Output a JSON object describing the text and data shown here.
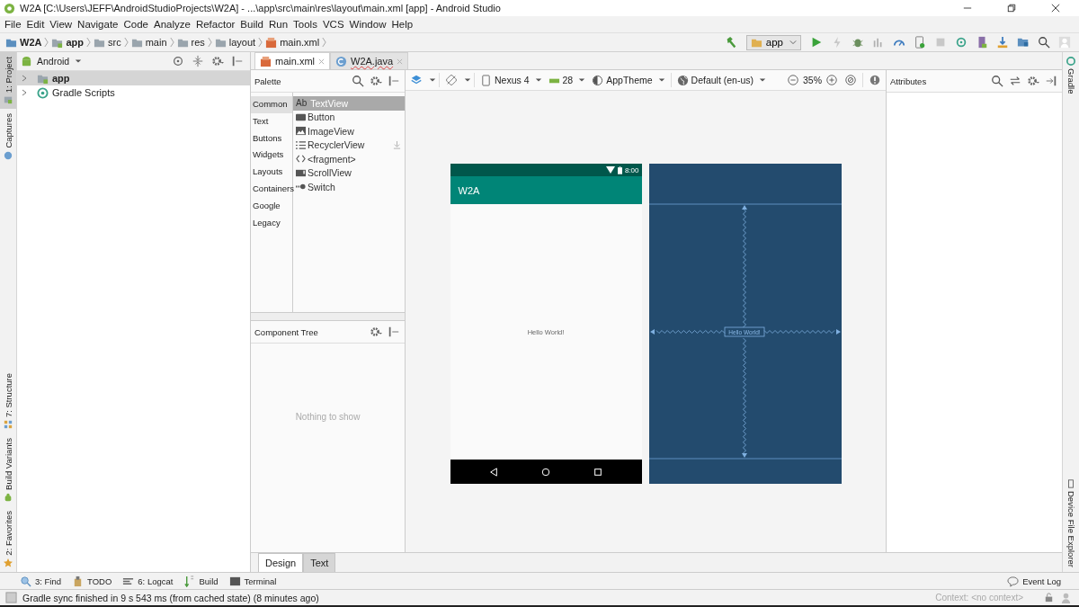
{
  "window": {
    "title": "W2A [C:\\Users\\JEFF\\AndroidStudioProjects\\W2A] - ...\\app\\src\\main\\res\\layout\\main.xml [app] - Android Studio"
  },
  "menu": [
    "File",
    "Edit",
    "View",
    "Navigate",
    "Code",
    "Analyze",
    "Refactor",
    "Build",
    "Run",
    "Tools",
    "VCS",
    "Window",
    "Help"
  ],
  "breadcrumbs": [
    {
      "label": "W2A",
      "kind": "project"
    },
    {
      "label": "app",
      "kind": "module"
    },
    {
      "label": "src",
      "kind": "folder"
    },
    {
      "label": "main",
      "kind": "folder"
    },
    {
      "label": "res",
      "kind": "folder"
    },
    {
      "label": "layout",
      "kind": "folder"
    },
    {
      "label": "main.xml",
      "kind": "file"
    }
  ],
  "run_config": "app",
  "left_tool_tabs_top": [
    {
      "label": "1: Project",
      "selected": true
    },
    {
      "label": "Captures",
      "selected": false
    }
  ],
  "left_tool_tabs_bottom": [
    {
      "label": "7: Structure",
      "selected": false
    },
    {
      "label": "Build Variants",
      "selected": false
    },
    {
      "label": "2: Favorites",
      "selected": false
    }
  ],
  "right_tool_tabs_top": [
    "Gradle"
  ],
  "right_tool_tabs_bottom": [
    "Device File Explorer"
  ],
  "project_panel": {
    "view": "Android",
    "tree": [
      {
        "label": "app",
        "expanded": false,
        "selected": true,
        "kind": "module"
      },
      {
        "label": "Gradle Scripts",
        "expanded": false,
        "selected": false,
        "kind": "gradle"
      }
    ]
  },
  "editor_tabs": [
    {
      "label": "main.xml",
      "selected": true,
      "kind": "xml"
    },
    {
      "label": "W2A.java",
      "selected": false,
      "kind": "java"
    }
  ],
  "palette": {
    "title": "Palette",
    "categories": [
      {
        "label": "Common",
        "selected": true
      },
      {
        "label": "Text",
        "selected": false
      },
      {
        "label": "Buttons",
        "selected": false
      },
      {
        "label": "Widgets",
        "selected": false
      },
      {
        "label": "Layouts",
        "selected": false
      },
      {
        "label": "Containers",
        "selected": false
      },
      {
        "label": "Google",
        "selected": false
      },
      {
        "label": "Legacy",
        "selected": false
      }
    ],
    "items": [
      {
        "label": "TextView",
        "kind": "text",
        "glyph": "Ab",
        "selected": true
      },
      {
        "label": "Button",
        "kind": "button",
        "selected": false
      },
      {
        "label": "ImageView",
        "kind": "image",
        "selected": false
      },
      {
        "label": "RecyclerView",
        "kind": "list",
        "selected": false,
        "download": true
      },
      {
        "label": "<fragment>",
        "kind": "fragment",
        "selected": false
      },
      {
        "label": "ScrollView",
        "kind": "scroll",
        "selected": false
      },
      {
        "label": "Switch",
        "kind": "switch",
        "selected": false
      }
    ]
  },
  "component_tree": {
    "title": "Component Tree",
    "empty_message": "Nothing to show"
  },
  "design_toolbar": {
    "device": "Nexus 4",
    "api": "28",
    "theme": "AppTheme",
    "locale": "Default (en-us)",
    "zoom": "35%"
  },
  "preview": {
    "status_time": "8:00",
    "app_title": "W2A",
    "content_text": "Hello World!"
  },
  "blueprint": {
    "content_text": "Hello World!"
  },
  "attributes": {
    "title": "Attributes"
  },
  "editor_mode_tabs": [
    {
      "label": "Design",
      "selected": true
    },
    {
      "label": "Text",
      "selected": false
    }
  ],
  "tool_windows": [
    {
      "label": "3: Find",
      "kind": "find"
    },
    {
      "label": "TODO",
      "kind": "todo"
    },
    {
      "label": "6: Logcat",
      "kind": "logcat"
    },
    {
      "label": "Build",
      "kind": "build"
    },
    {
      "label": "Terminal",
      "kind": "terminal"
    }
  ],
  "event_log": "Event Log",
  "status": {
    "message": "Gradle sync finished in 9 s 543 ms (from cached state) (8 minutes ago)",
    "context": "Context: <no context>"
  }
}
